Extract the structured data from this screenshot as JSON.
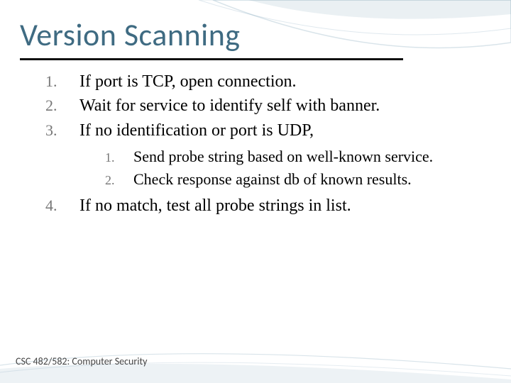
{
  "title": "Version Scanning",
  "items": [
    {
      "n": "1.",
      "text": "If port is TCP, open connection."
    },
    {
      "n": "2.",
      "text": "Wait for service to identify self with banner."
    },
    {
      "n": "3.",
      "text": "If no identification or port is UDP,"
    }
  ],
  "subitems": [
    {
      "n": "1.",
      "text": "Send probe string based on well-known service."
    },
    {
      "n": "2.",
      "text": "Check response against db of known results."
    }
  ],
  "items2": [
    {
      "n": "4.",
      "text": "If no match, test all probe strings in list."
    }
  ],
  "footer": "CSC 482/582: Computer Security"
}
